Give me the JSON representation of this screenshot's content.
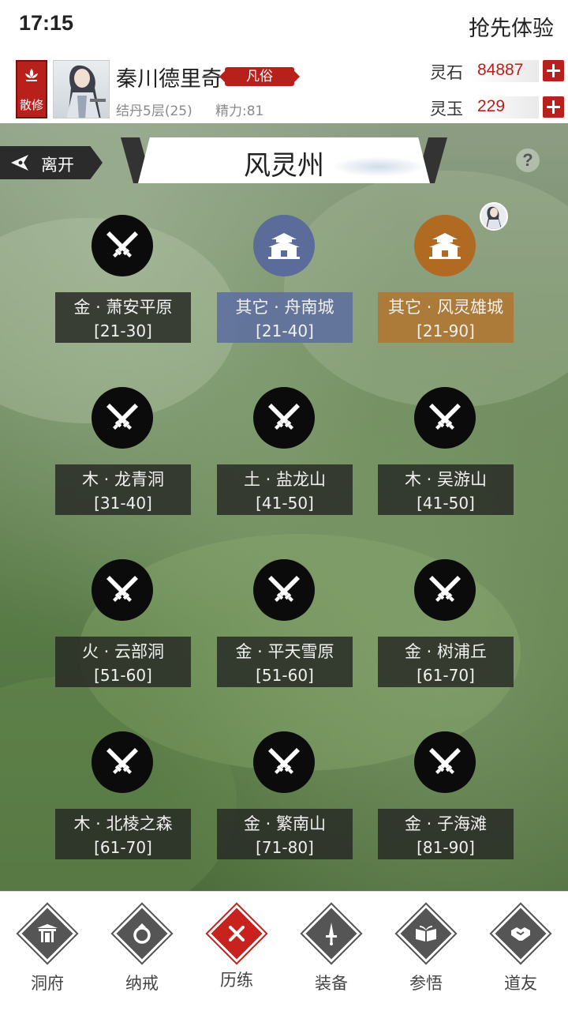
{
  "status_bar": {
    "time": "17:15",
    "early_access": "抢先体验"
  },
  "player": {
    "sect": "散修",
    "name": "秦川德里奇",
    "rank": "凡俗",
    "cultivation": "结丹5层(25)",
    "stamina": "精力:81"
  },
  "currency": [
    {
      "label": "灵石",
      "value": "84887"
    },
    {
      "label": "灵玉",
      "value": "229"
    }
  ],
  "map": {
    "leave_label": "离开",
    "title": "风灵州",
    "help": "?",
    "locations": [
      {
        "name": "金 · 萧安平原",
        "levels": "[21-30]",
        "kind": "battle"
      },
      {
        "name": "其它 · 舟南城",
        "levels": "[21-40]",
        "kind": "city-blue"
      },
      {
        "name": "其它 · 风灵雄城",
        "levels": "[21-90]",
        "kind": "city-orange"
      },
      {
        "name": "木 · 龙青洞",
        "levels": "[31-40]",
        "kind": "battle"
      },
      {
        "name": "土 · 盐龙山",
        "levels": "[41-50]",
        "kind": "battle"
      },
      {
        "name": "木 · 吴游山",
        "levels": "[41-50]",
        "kind": "battle"
      },
      {
        "name": "火 · 云部洞",
        "levels": "[51-60]",
        "kind": "battle"
      },
      {
        "name": "金 · 平天雪原",
        "levels": "[51-60]",
        "kind": "battle"
      },
      {
        "name": "金 · 树浦丘",
        "levels": "[61-70]",
        "kind": "battle"
      },
      {
        "name": "木 · 北棱之森",
        "levels": "[61-70]",
        "kind": "battle"
      },
      {
        "name": "金 · 繁南山",
        "levels": "[71-80]",
        "kind": "battle"
      },
      {
        "name": "金 · 子海滩",
        "levels": "[81-90]",
        "kind": "battle"
      }
    ]
  },
  "nav": [
    {
      "label": "洞府",
      "icon": "gate-icon"
    },
    {
      "label": "纳戒",
      "icon": "ring-icon"
    },
    {
      "label": "历练",
      "icon": "cross-swords-icon"
    },
    {
      "label": "装备",
      "icon": "dagger-icon"
    },
    {
      "label": "参悟",
      "icon": "book-icon"
    },
    {
      "label": "道友",
      "icon": "handshake-icon"
    }
  ],
  "active_nav": "历练",
  "colors": {
    "accent_red": "#b8201c",
    "city_blue": "#5b6b9a",
    "city_orange": "#b06a22"
  }
}
